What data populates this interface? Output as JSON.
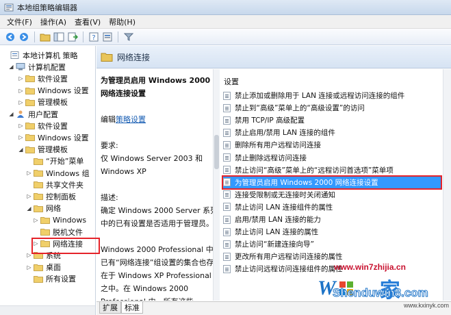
{
  "window": {
    "title": "本地组策略编辑器"
  },
  "menu": [
    "文件(F)",
    "操作(A)",
    "查看(V)",
    "帮助(H)"
  ],
  "toolbar": {
    "icons": [
      "back-arrow-icon",
      "forward-arrow-icon",
      "up-folder-icon",
      "show-hide-tree-icon",
      "export-list-icon",
      "help-icon",
      "properties-icon",
      "filter-icon"
    ]
  },
  "tree": [
    {
      "label": "本地计算机 策略",
      "level": 0,
      "icon": "policy-icon",
      "expand": ""
    },
    {
      "label": "计算机配置",
      "level": 1,
      "icon": "computer-icon",
      "expand": "◢"
    },
    {
      "label": "软件设置",
      "level": 2,
      "icon": "folder-icon",
      "expand": "▷"
    },
    {
      "label": "Windows 设置",
      "level": 2,
      "icon": "folder-icon",
      "expand": "▷"
    },
    {
      "label": "管理模板",
      "level": 2,
      "icon": "folder-icon",
      "expand": "▷"
    },
    {
      "label": "用户配置",
      "level": 1,
      "icon": "user-icon",
      "expand": "◢"
    },
    {
      "label": "软件设置",
      "level": 2,
      "icon": "folder-icon",
      "expand": "▷"
    },
    {
      "label": "Windows 设置",
      "level": 2,
      "icon": "folder-icon",
      "expand": "▷"
    },
    {
      "label": "管理模板",
      "level": 2,
      "icon": "folder-icon",
      "expand": "◢"
    },
    {
      "label": "“开始”菜单",
      "level": 3,
      "icon": "folder-icon",
      "expand": ""
    },
    {
      "label": "Windows 组",
      "level": 3,
      "icon": "folder-icon",
      "expand": "▷"
    },
    {
      "label": "共享文件夹",
      "level": 3,
      "icon": "folder-icon",
      "expand": ""
    },
    {
      "label": "控制面板",
      "level": 3,
      "icon": "folder-icon",
      "expand": "▷"
    },
    {
      "label": "网络",
      "level": 3,
      "icon": "folder-icon",
      "expand": "◢"
    },
    {
      "label": "Windows",
      "level": 4,
      "icon": "folder-icon",
      "expand": "▷"
    },
    {
      "label": "脱机文件",
      "level": 4,
      "icon": "folder-icon",
      "expand": ""
    },
    {
      "label": "网络连接",
      "level": 4,
      "icon": "folder-icon",
      "expand": "▷",
      "selected": true
    },
    {
      "label": "系统",
      "level": 3,
      "icon": "folder-icon",
      "expand": "▷"
    },
    {
      "label": "桌面",
      "level": 3,
      "icon": "folder-icon",
      "expand": "▷"
    },
    {
      "label": "所有设置",
      "level": 3,
      "icon": "folder-icon",
      "expand": ""
    }
  ],
  "panel": {
    "title": "网络连接"
  },
  "description": {
    "heading": "为管理员启用 Windows 2000 网络连接设置",
    "edit_prefix": "编辑",
    "edit_link": "策略设置",
    "req_label": "要求:",
    "req_text": "仅 Windows Server 2003 和 Windows XP",
    "desc_label": "描述:",
    "desc_text1": "确定 Windows 2000 Server 系列中的已有设置是否适用于管理员。",
    "desc_text2": "Windows 2000 Professional 中已有“网络连接”组设置的集合也存在于 Windows XP Professional 之中。在 Windows 2000 Professional 中，所有这些"
  },
  "settings": {
    "header": "设置",
    "items": [
      "禁止添加或删除用于 LAN 连接或远程访问连接的组件",
      "禁止到“高级”菜单上的“高级设置”的访问",
      "禁用 TCP/IP 高级配置",
      "禁止启用/禁用 LAN 连接的组件",
      "删除所有用户远程访问连接",
      "禁止删除远程访问连接",
      "禁止访问“高级”菜单上的“远程访问首选项”菜单项",
      "为管理员启用 Windows 2000 网络连接设置",
      "连接受限制或无连接时关闭通知",
      "禁止访问 LAN 连接组件的属性",
      "启用/禁用 LAN 连接的能力",
      "禁止访问 LAN 连接的属性",
      "禁止访问“新建连接向导”",
      "更改所有用户远程访问连接的属性",
      "禁止访问远程访问连接组件的属性"
    ],
    "selected_index": 7
  },
  "tabs": [
    "扩展",
    "标准"
  ],
  "watermark": {
    "site": "www.win7zhijia.cn",
    "brand_a": "W",
    "brand_b": "家",
    "logo": "Shenduwin8.com",
    "small": "www.kxinyk.com"
  }
}
